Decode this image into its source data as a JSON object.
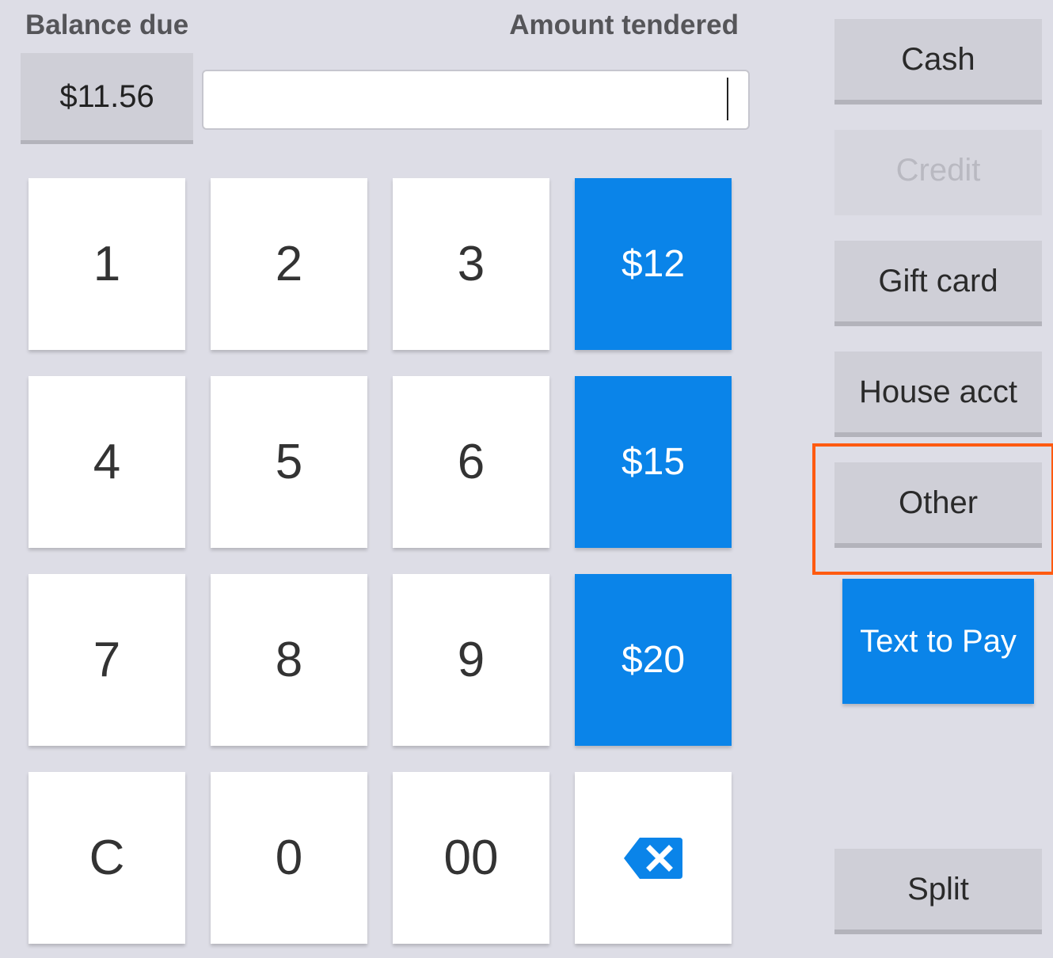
{
  "header": {
    "balance_label": "Balance due",
    "tendered_label": "Amount tendered"
  },
  "balance": {
    "value": "$11.56"
  },
  "tender_input": {
    "value": "",
    "placeholder": ""
  },
  "keypad": {
    "k1": "1",
    "k2": "2",
    "k3": "3",
    "k4": "4",
    "k5": "5",
    "k6": "6",
    "k7": "7",
    "k8": "8",
    "k9": "9",
    "kC": "C",
    "k0": "0",
    "k00": "00",
    "quick1": "$12",
    "quick2": "$15",
    "quick3": "$20",
    "backspace_icon": "backspace-icon"
  },
  "payment_methods": {
    "cash": "Cash",
    "credit": "Credit",
    "gift_card": "Gift card",
    "house_acct": "House acct",
    "other": "Other",
    "text_to_pay": "Text to Pay",
    "split": "Split"
  },
  "colors": {
    "accent": "#0a84e9",
    "highlight": "#ff5a10",
    "background": "#dddde6"
  }
}
